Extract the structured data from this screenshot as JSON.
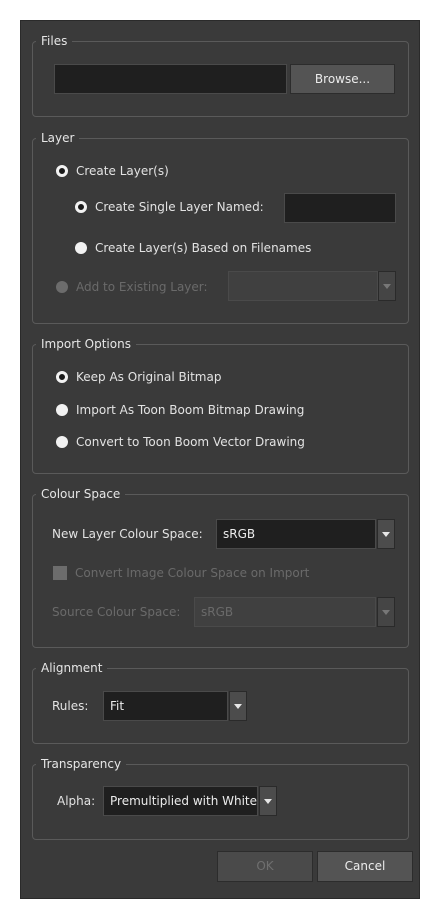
{
  "files": {
    "legend": "Files",
    "path_value": "",
    "browse_label": "Browse..."
  },
  "layer": {
    "legend": "Layer",
    "create_layers": "Create Layer(s)",
    "create_single": "Create Single Layer Named:",
    "single_name_value": "",
    "create_from_filenames": "Create Layer(s) Based on Filenames",
    "add_existing": "Add to Existing Layer:",
    "existing_value": ""
  },
  "import_options": {
    "legend": "Import Options",
    "keep_original": "Keep As Original Bitmap",
    "import_toon_boom_bitmap": "Import As Toon Boom Bitmap Drawing",
    "convert_vector": "Convert to Toon Boom Vector Drawing"
  },
  "colour_space": {
    "legend": "Colour Space",
    "new_layer_label": "New Layer Colour Space:",
    "new_layer_value": "sRGB",
    "convert_label": "Convert Image Colour Space on Import",
    "source_label": "Source Colour Space:",
    "source_value": "sRGB"
  },
  "alignment": {
    "legend": "Alignment",
    "rules_label": "Rules:",
    "rules_value": "Fit"
  },
  "transparency": {
    "legend": "Transparency",
    "alpha_label": "Alpha:",
    "alpha_value": "Premultiplied with White"
  },
  "buttons": {
    "ok": "OK",
    "cancel": "Cancel"
  },
  "colors": {
    "background": "#3a3a3a",
    "field": "#1f1f1f",
    "text": "#e3e3e3",
    "disabled_text": "#6a6a6a"
  }
}
